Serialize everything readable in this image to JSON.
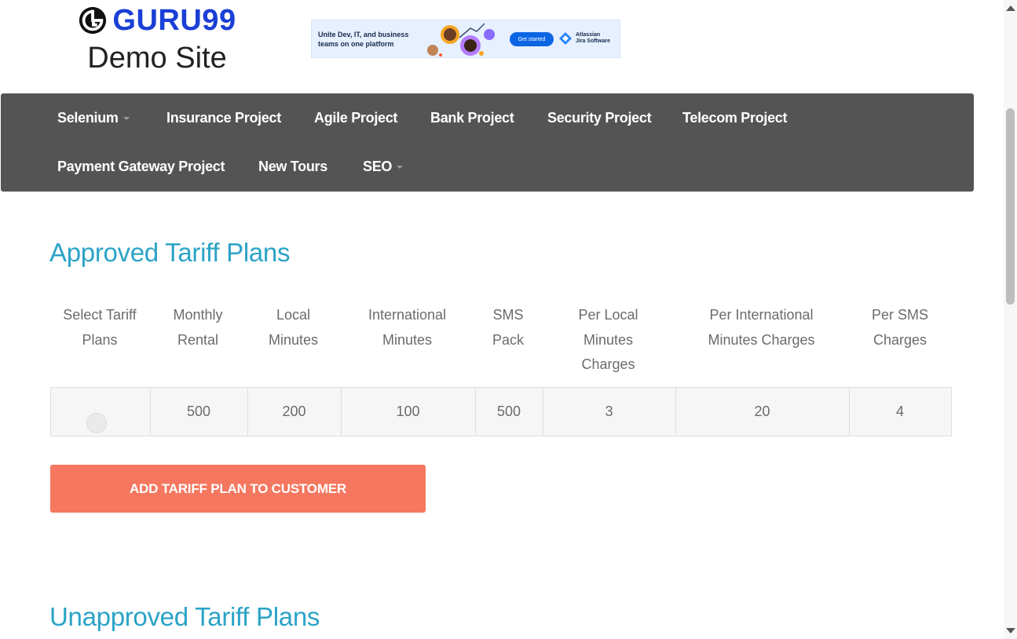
{
  "header": {
    "logo_text": "GURU99",
    "site_title": "Demo Site",
    "ad": {
      "text": "Unite Dev, IT, and business teams on one platform",
      "cta": "Get started",
      "brand_line1": "Atlassian",
      "brand_line2": "Jira Software"
    }
  },
  "nav": {
    "items": [
      {
        "label": "Selenium",
        "dropdown": true
      },
      {
        "label": "Insurance Project"
      },
      {
        "label": "Agile Project"
      },
      {
        "label": "Bank Project"
      },
      {
        "label": "Security Project"
      },
      {
        "label": "Telecom Project"
      },
      {
        "label": "Payment Gateway Project"
      },
      {
        "label": "New Tours"
      },
      {
        "label": "SEO",
        "dropdown": true
      }
    ]
  },
  "approved": {
    "title": "Approved Tariff Plans",
    "headers": [
      "Select Tariff Plans",
      "Monthly Rental",
      "Local Minutes",
      "International Minutes",
      "SMS Pack",
      "Per Local Minutes Charges",
      "Per International Minutes Charges",
      "Per SMS Charges"
    ],
    "rows": [
      {
        "monthly_rental": "500",
        "local_minutes": "200",
        "international_minutes": "100",
        "sms_pack": "500",
        "per_local": "3",
        "per_international": "20",
        "per_sms": "4"
      }
    ],
    "button": "ADD TARIFF PLAN TO CUSTOMER"
  },
  "unapproved": {
    "title": "Unapproved Tariff Plans"
  },
  "colors": {
    "brand": "#1a3fd6",
    "nav_bg": "#545454",
    "heading": "#2ba3c6",
    "button": "#f5775f"
  }
}
